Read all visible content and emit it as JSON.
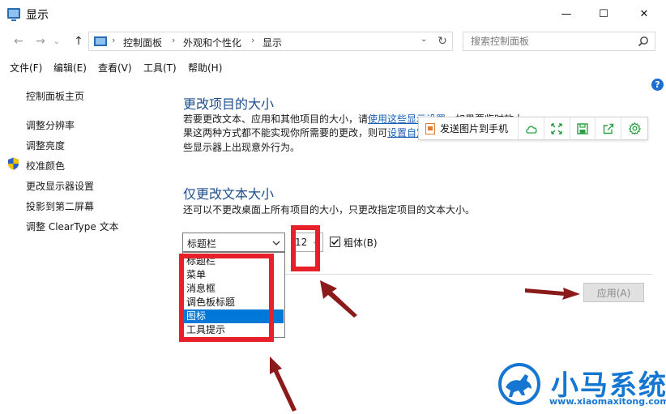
{
  "window": {
    "title": "显示",
    "minimize_glyph": "—",
    "maximize_glyph": "☐",
    "close_glyph": "✕"
  },
  "nav": {
    "back_glyph": "←",
    "forward_glyph": "→",
    "recent_glyph": "⌄",
    "up_glyph": "↑",
    "refresh_glyph": "↻",
    "breadcrumb": [
      "控制面板",
      "外观和个性化",
      "显示"
    ],
    "separator_glyph": "›",
    "search_placeholder": "搜索控制面板"
  },
  "menu": [
    "文件(F)",
    "编辑(E)",
    "查看(V)",
    "工具(T)",
    "帮助(H)"
  ],
  "help_glyph": "?",
  "sidebar": {
    "home": "控制面板主页",
    "links": [
      "调整分辨率",
      "调整亮度",
      "校准颜色",
      "更改显示器设置",
      "投影到第二屏幕",
      "调整 ClearType 文本"
    ]
  },
  "main": {
    "section1_title": "更改项目的大小",
    "p1_line1_a": "若要更改文本、应用和其他项目的大小，请",
    "p1_line1_link": "使用这些显示设置",
    "p1_line1_b": "。如果要临时放大",
    "p1_line2_a": "果这两种方式都不能实现你所需要的更改，则可",
    "p1_line2_link": "设置自定",
    "p1_line3": "些显示器上出现意外行为。",
    "section2_title": "仅更改文本大小",
    "p2": "还可以不更改桌面上所有项目的大小，只更改指定项目的文本大小。",
    "item_select_value": "标题栏",
    "size_select_value": "12",
    "bold_label": "粗体(B)",
    "dropdown_options": [
      "标题栏",
      "菜单",
      "消息框",
      "调色板标题",
      "图标",
      "工具提示"
    ],
    "dropdown_selected": "图标",
    "apply_label": "应用(A)"
  },
  "share_toolbar": {
    "send_label": "发送图片到手机",
    "icons": [
      "cloud-icon",
      "expand-icon",
      "save-icon",
      "share-icon",
      "settings-icon"
    ],
    "icon_color": "#2ea043"
  },
  "watermark": {
    "brand": "小马系统",
    "url": "www.xiaomaxitong.com",
    "color": "#1677d2"
  },
  "annotation_color": "#e8202a",
  "arrow_color": "#8b1a1a"
}
